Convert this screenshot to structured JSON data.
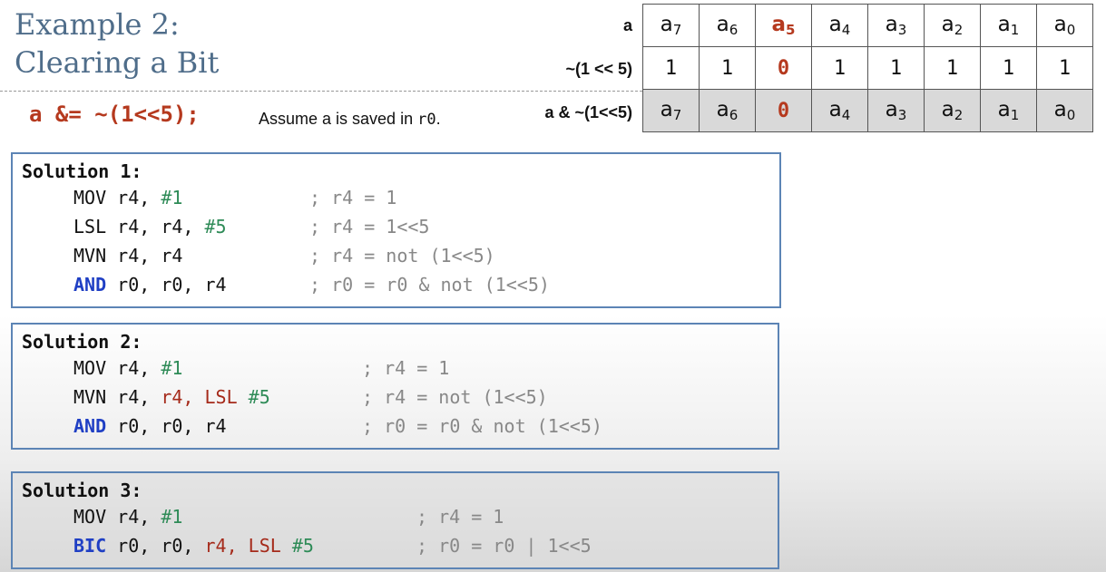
{
  "title": {
    "line1": "Example 2:",
    "line2": "Clearing a Bit"
  },
  "statement": {
    "code": "a &= ~(1<<5);",
    "note_prefix": "Assume a is saved in ",
    "note_reg": "r0",
    "note_suffix": "."
  },
  "table": {
    "row_labels": [
      "a",
      "~(1 << 5)",
      "a & ~(1<<5)"
    ],
    "row_a": [
      {
        "base": "a",
        "sub": "7"
      },
      {
        "base": "a",
        "sub": "6"
      },
      {
        "base": "a",
        "sub": "5"
      },
      {
        "base": "a",
        "sub": "4"
      },
      {
        "base": "a",
        "sub": "3"
      },
      {
        "base": "a",
        "sub": "2"
      },
      {
        "base": "a",
        "sub": "1"
      },
      {
        "base": "a",
        "sub": "0"
      }
    ],
    "row_mask": [
      "1",
      "1",
      "0",
      "1",
      "1",
      "1",
      "1",
      "1"
    ],
    "row_result": [
      {
        "base": "a",
        "sub": "7"
      },
      {
        "base": "a",
        "sub": "6"
      },
      {
        "base": "0",
        "sub": ""
      },
      {
        "base": "a",
        "sub": "4"
      },
      {
        "base": "a",
        "sub": "3"
      },
      {
        "base": "a",
        "sub": "2"
      },
      {
        "base": "a",
        "sub": "1"
      },
      {
        "base": "a",
        "sub": "0"
      }
    ],
    "highlight_color": "#b5391e"
  },
  "solutions": [
    {
      "title": "Solution 1:",
      "lines": [
        {
          "op": "MOV",
          "op_style": "plain",
          "args": [
            [
              "r4, ",
              "plain"
            ],
            [
              "#1",
              "green"
            ]
          ],
          "comment": "; r4 = 1"
        },
        {
          "op": "LSL",
          "op_style": "plain",
          "args": [
            [
              "r4, r4, ",
              "plain"
            ],
            [
              "#5",
              "green"
            ]
          ],
          "comment": "; r4 = 1<<5"
        },
        {
          "op": "MVN",
          "op_style": "plain",
          "args": [
            [
              "r4, r4",
              "plain"
            ]
          ],
          "comment": "; r4 = not (1<<5)"
        },
        {
          "op": "AND",
          "op_style": "blue",
          "args": [
            [
              "r0, r0, r4",
              "plain"
            ]
          ],
          "comment": "; r0 = r0 & not (1<<5)"
        }
      ]
    },
    {
      "title": "Solution 2:",
      "lines": [
        {
          "op": "MOV",
          "op_style": "plain",
          "args": [
            [
              "r4, ",
              "plain"
            ],
            [
              "#1",
              "green"
            ]
          ],
          "comment": "; r4 = 1"
        },
        {
          "op": "MVN",
          "op_style": "plain",
          "args": [
            [
              "r4, ",
              "plain"
            ],
            [
              "r4, LSL ",
              "red"
            ],
            [
              "#5",
              "green"
            ]
          ],
          "comment": "; r4 = not (1<<5)"
        },
        {
          "op": "AND",
          "op_style": "blue",
          "args": [
            [
              "r0, r0, r4",
              "plain"
            ]
          ],
          "comment": "; r0 = r0 & not (1<<5)"
        }
      ]
    },
    {
      "title": "Solution 3:",
      "lines": [
        {
          "op": "MOV",
          "op_style": "plain",
          "args": [
            [
              "r4, ",
              "plain"
            ],
            [
              "#1",
              "green"
            ]
          ],
          "comment": "; r4 = 1"
        },
        {
          "op": "BIC",
          "op_style": "blue",
          "args": [
            [
              "r0, r0, ",
              "plain"
            ],
            [
              "r4, LSL ",
              "red"
            ],
            [
              "#5",
              "green"
            ]
          ],
          "comment": "; r0 = r0 | 1<<5"
        }
      ]
    }
  ],
  "colors": {
    "title": "#4f6d8a",
    "box_border": "#5c84b5",
    "immediate": "#2e8b57",
    "shift": "#a52a1a",
    "keyword": "#1f3fc4",
    "comment": "#888888"
  }
}
